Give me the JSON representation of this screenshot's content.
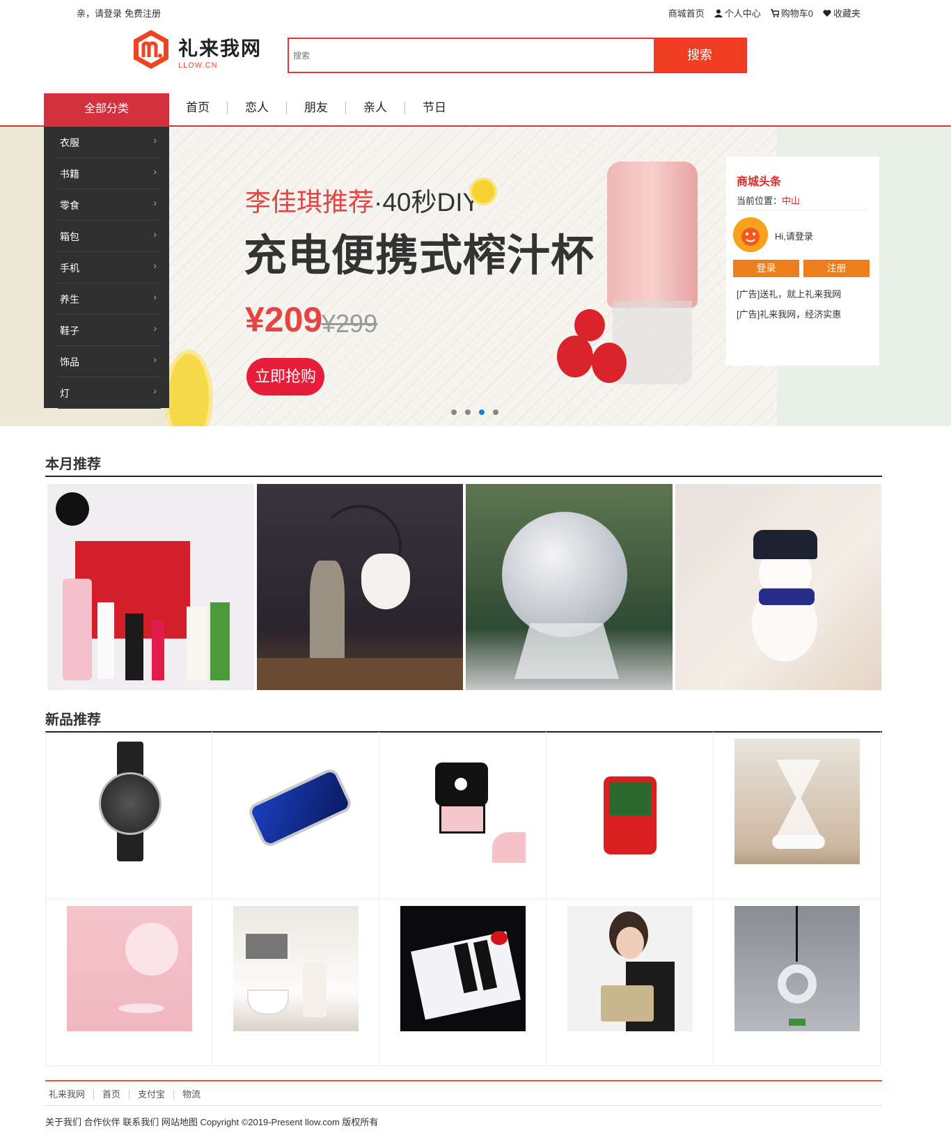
{
  "topbar": {
    "greeting": "亲，请登录",
    "register": "免费注册",
    "links": [
      "商城首页",
      "个人中心",
      "购物车0",
      "收藏夹"
    ]
  },
  "logo": {
    "name": "礼来我网",
    "sub": "LLOW.CN"
  },
  "search": {
    "placeholder": "搜索",
    "button": "搜索"
  },
  "nav": {
    "category_title": "全部分类",
    "links": [
      "首页",
      "恋人",
      "朋友",
      "亲人",
      "节日"
    ]
  },
  "categories": [
    "衣服",
    "书籍",
    "零食",
    "箱包",
    "手机",
    "养生",
    "鞋子",
    "饰品",
    "灯"
  ],
  "banner": {
    "line1_red": "李佳琪推荐",
    "line1_rest": "·40秒DIY",
    "title": "充电便携式榨汁杯",
    "price": "¥209",
    "old_price": "¥299",
    "button": "立即抢购"
  },
  "news": {
    "title": "商城头条",
    "location_label": "当前位置：",
    "location_value": "中山",
    "greeting": "Hi,请登录",
    "login": "登录",
    "register": "注册",
    "ads": [
      "[广告]送礼，就上礼来我网",
      "[广告]礼来我网，经济实惠"
    ]
  },
  "sections": {
    "month": "本月推荐",
    "new": "新品推荐"
  },
  "footer": {
    "links": [
      "礼来我网",
      "首页",
      "支付宝",
      "物流"
    ],
    "copyright": "关于我们 合作伙伴 联系我们 网站地图 Copyright ©2019-Present llow.com 版权所有"
  },
  "colors": {
    "accent": "#d2313d",
    "search": "#ee3d23",
    "orange": "#ee7d1c"
  }
}
